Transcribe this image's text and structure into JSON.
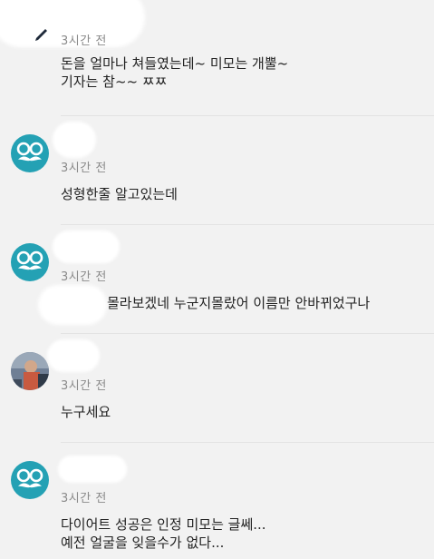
{
  "comments": [
    {
      "author": "",
      "time": "3시간 전",
      "text": "돈을 얼마나 쳐들였는데~ 미모는 개뿔~\n기자는 참~~ ㅉㅉ",
      "avatar_icon": "mustache-glasses-icon"
    },
    {
      "author": "",
      "time": "3시간 전",
      "text": "성형한줄 알고있는데",
      "avatar_icon": "mustache-glasses-icon"
    },
    {
      "author": "",
      "time": "3시간 전",
      "text": "몰라보겠네 누군지몰랐어 이름만 안바뀌었구나",
      "avatar_icon": "mustache-glasses-icon"
    },
    {
      "author": "",
      "time": "3시간 전",
      "text": "누구세요",
      "avatar_icon": "profile-photo"
    },
    {
      "author": "",
      "time": "3시간 전",
      "text": "다이어트 성공은 인정 미모는 글쎄...\n예전 얼굴을 잊을수가 없다...",
      "avatar_icon": "mustache-glasses-icon"
    }
  ],
  "colors": {
    "background": "#f2f2f2",
    "avatar_teal": "#24a1b4",
    "time_text": "#8a8a8a",
    "body_text": "#222222",
    "divider": "#e3e3e3"
  }
}
